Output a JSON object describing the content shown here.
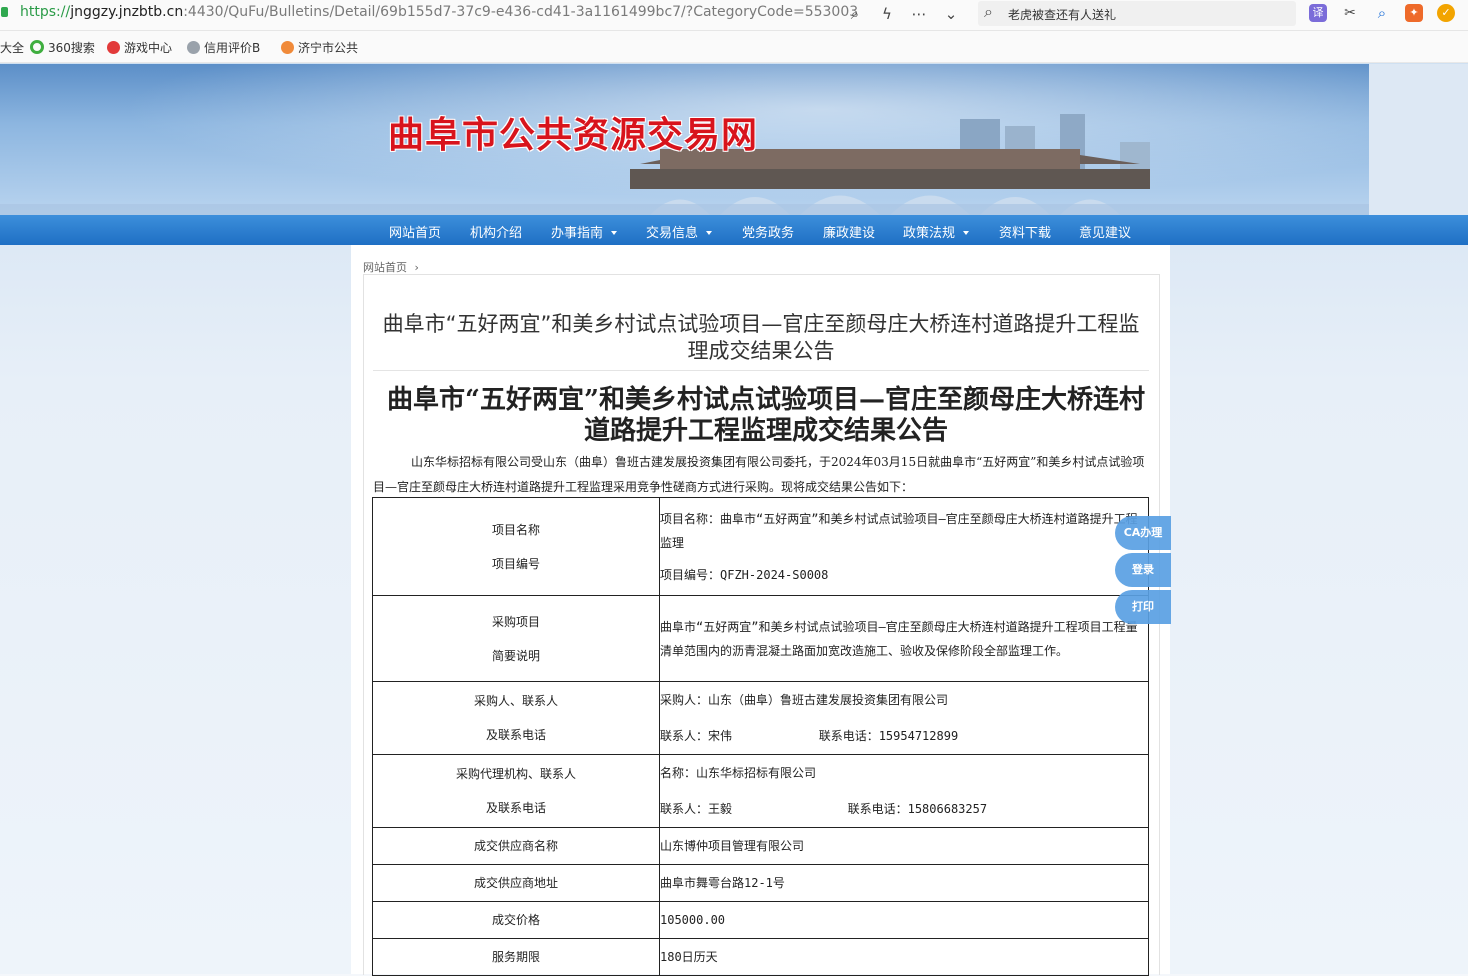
{
  "browser": {
    "url_scheme": "https://",
    "url_host": "jnggzy.jnzbtb.cn",
    "url_rest": ":4430/QuFu/Bulletins/Detail/69b155d7-37c9-e436-cd41-3a1161499bc7/?CategoryCode=553003",
    "search_text": "老虎被查还有人送礼",
    "icons": [
      "search-icon",
      "lightning-icon",
      "more-icon",
      "chevron-down-icon"
    ],
    "extension_label": "译"
  },
  "bookmarks": [
    {
      "label": "大全"
    },
    {
      "label": "360搜索"
    },
    {
      "label": "游戏中心"
    },
    {
      "label": "信用评价B"
    },
    {
      "label": "济宁市公共"
    }
  ],
  "site": {
    "banner_title": "曲阜市公共资源交易网",
    "nav": [
      {
        "label": "网站首页",
        "dropdown": false
      },
      {
        "label": "机构介绍",
        "dropdown": false
      },
      {
        "label": "办事指南",
        "dropdown": true
      },
      {
        "label": "交易信息",
        "dropdown": true
      },
      {
        "label": "党务政务",
        "dropdown": false
      },
      {
        "label": "廉政建设",
        "dropdown": false
      },
      {
        "label": "政策法规",
        "dropdown": true
      },
      {
        "label": "资料下载",
        "dropdown": false
      },
      {
        "label": "意见建议",
        "dropdown": false
      }
    ],
    "breadcrumb": "网站首页",
    "breadcrumb_sep": "›"
  },
  "article": {
    "header_title": "曲阜市“五好两宜”和美乡村试点试验项目—官庄至颜母庄大桥连村道路提升工程监理成交结果公告",
    "body_title": "曲阜市“五好两宜”和美乡村试点试验项目—官庄至颜母庄大桥连村道路提升工程监理成交结果公告",
    "intro": "山东华标招标有限公司受山东（曲阜）鲁班古建发展投资集团有限公司委托，于2024年03月15日就曲阜市“五好两宜”和美乡村试点试验项目—官庄至颜母庄大桥连村道路提升工程监理采用竞争性磋商方式进行采购。现将成交结果公告如下：",
    "rows": [
      {
        "left": [
          "项目名称",
          "项目编号"
        ],
        "right": [
          "项目名称：曲阜市“五好两宜”和美乡村试点试验项目—官庄至颜母庄大桥连村道路提升工程监理",
          "项目编号：QFZH-2024-S0008"
        ]
      },
      {
        "left": [
          "采购项目",
          "简要说明"
        ],
        "right": [
          "曲阜市“五好两宜”和美乡村试点试验项目—官庄至颜母庄大桥连村道路提升工程项目工程量清单范围内的沥青混凝土路面加宽改造施工、验收及保修阶段全部监理工作。"
        ]
      },
      {
        "left": [
          "采购人、联系人",
          "及联系电话"
        ],
        "right": [
          "采购人：山东（曲阜）鲁班古建发展投资集团有限公司",
          "联系人：宋伟            联系电话：15954712899"
        ]
      },
      {
        "left": [
          "采购代理机构、联系人",
          "及联系电话"
        ],
        "right": [
          "名称：山东华标招标有限公司",
          "联系人：王毅                联系电话：15806683257"
        ]
      },
      {
        "left": [
          "成交供应商名称"
        ],
        "right": [
          "山东博仲项目管理有限公司"
        ]
      },
      {
        "left": [
          "成交供应商地址"
        ],
        "right": [
          "曲阜市舞雩台路12-1号"
        ]
      },
      {
        "left": [
          "成交价格"
        ],
        "right": [
          "105000.00"
        ]
      },
      {
        "left": [
          "服务期限"
        ],
        "right": [
          "180日历天"
        ]
      }
    ]
  },
  "side_buttons": [
    {
      "label": "CA办理"
    },
    {
      "label": "登录"
    },
    {
      "label": "打印"
    }
  ]
}
